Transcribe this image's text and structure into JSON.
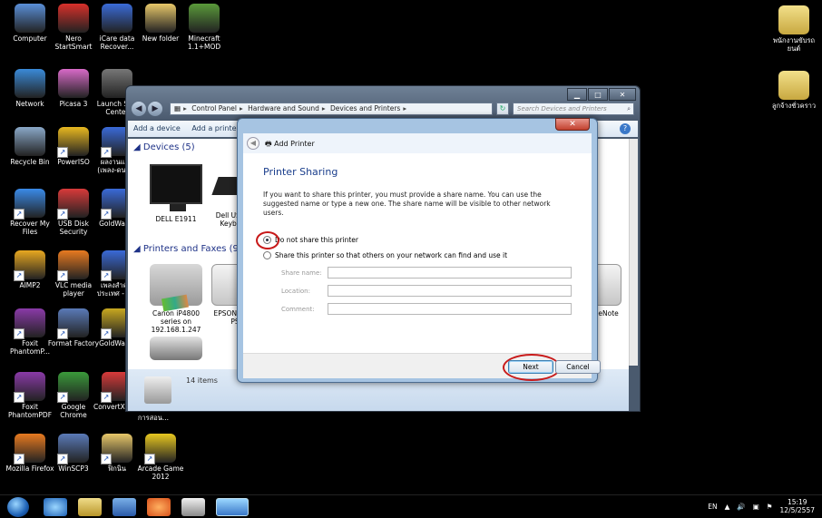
{
  "desktop_icons": [
    {
      "label": "Computer",
      "color": "#5a8fd8",
      "icon": "computer-icon"
    },
    {
      "label": "Nero StartSmart",
      "color": "#d8302a",
      "icon": "nero-icon"
    },
    {
      "label": "iCare data Recover...",
      "color": "#3a6bd8",
      "icon": "icare-icon"
    },
    {
      "label": "New folder",
      "color": "#e8c86a",
      "icon": "folder-icon"
    },
    {
      "label": "Minecraft 1.1+MOD",
      "color": "#5a9a3a",
      "icon": "minecraft-icon"
    },
    {
      "label": "Network",
      "color": "#3a8ad8",
      "icon": "network-icon"
    },
    {
      "label": "Picasa 3",
      "color": "#d86ac8",
      "icon": "picasa-icon"
    },
    {
      "label": "Launch St... Center",
      "color": "#777777",
      "icon": "launch-center-icon"
    },
    {
      "label": "Recycle Bin",
      "color": "#8aa8c8",
      "icon": "recycle-bin-icon"
    },
    {
      "label": "PowerISO",
      "color": "#e8b820",
      "icon": "poweriso-icon"
    },
    {
      "label": "ผลงานแผ่น (เพลง-ดนต...",
      "color": "#3a6ad8",
      "icon": "document-icon"
    },
    {
      "label": "Recover My Files",
      "color": "#3a8ae8",
      "icon": "recover-files-icon"
    },
    {
      "label": "USB Disk Security",
      "color": "#d83a3a",
      "icon": "usb-security-icon"
    },
    {
      "label": "GoldWav...",
      "color": "#3a6ad8",
      "icon": "word-doc-icon"
    },
    {
      "label": "AIMP2",
      "color": "#e8a820",
      "icon": "aimp-icon"
    },
    {
      "label": "VLC media player",
      "color": "#e87a20",
      "icon": "vlc-icon"
    },
    {
      "label": "เพลงสำคัญ ประเทศ - แ...",
      "color": "#3a6ad8",
      "icon": "document-icon"
    },
    {
      "label": "Foxit PhantomP...",
      "color": "#8a3aa8",
      "icon": "foxit-phantom-icon"
    },
    {
      "label": "Format Factory",
      "color": "#5a7ab8",
      "icon": "format-factory-icon"
    },
    {
      "label": "GoldWav...",
      "color": "#c8a820",
      "icon": "goldwave-icon"
    },
    {
      "label": "Foxit PhantomPDF",
      "color": "#8a3aa8",
      "icon": "foxit-pdf-icon"
    },
    {
      "label": "Google Chrome",
      "color": "#3a9a3a",
      "icon": "chrome-icon"
    },
    {
      "label": "ConvertXt... 4",
      "color": "#d83a3a",
      "icon": "convertx-icon"
    },
    {
      "label": "การสอน...",
      "color": "#444444",
      "icon": "folder-icon"
    },
    {
      "label": "Mozilla Firefox",
      "color": "#e87a20",
      "icon": "firefox-icon"
    },
    {
      "label": "WinSCP3",
      "color": "#5a7ab8",
      "icon": "winscp-icon"
    },
    {
      "label": "ฟิกนิน",
      "color": "#e8c86a",
      "icon": "folder-icon"
    },
    {
      "label": "Arcade Game 2012",
      "color": "#e8c820",
      "icon": "arcade-icon"
    }
  ],
  "right_icons": [
    {
      "label": "พนักงานขับรถ ยนต์",
      "icon": "folder-icon"
    },
    {
      "label": "ลูกจ้างชั่วคราว",
      "icon": "folder-icon"
    }
  ],
  "explorer": {
    "breadcrumb": [
      "Control Panel",
      "Hardware and Sound",
      "Devices and Printers"
    ],
    "search_placeholder": "Search Devices and Printers",
    "commands": [
      "Add a device",
      "Add a printer"
    ],
    "group_devices": "Devices (5)",
    "group_printers": "Printers and Faxes (9)",
    "devices": [
      {
        "label": "DELL E1911"
      },
      {
        "label": "Dell USB E... Keyboar..."
      }
    ],
    "printers": [
      {
        "label": "Canon iP4800 series on 192.168.1.247"
      },
      {
        "label": "EPSON AL-... PS"
      },
      {
        "label": "...eNote"
      }
    ],
    "status_count": "14 items"
  },
  "dialog": {
    "title": "Add Printer",
    "heading": "Printer Sharing",
    "description": "If you want to share this printer, you must provide a share name. You can use the suggested name or type a new one. The share name will be visible to other network users.",
    "option_no_share": "Do not share this printer",
    "option_share": "Share this printer so that others on your network can find and use it",
    "share_name_label": "Share name:",
    "location_label": "Location:",
    "comment_label": "Comment:",
    "next_label": "Next",
    "cancel_label": "Cancel"
  },
  "taskbar": {
    "lang": "EN",
    "time": "15:19",
    "date": "12/5/2557"
  }
}
